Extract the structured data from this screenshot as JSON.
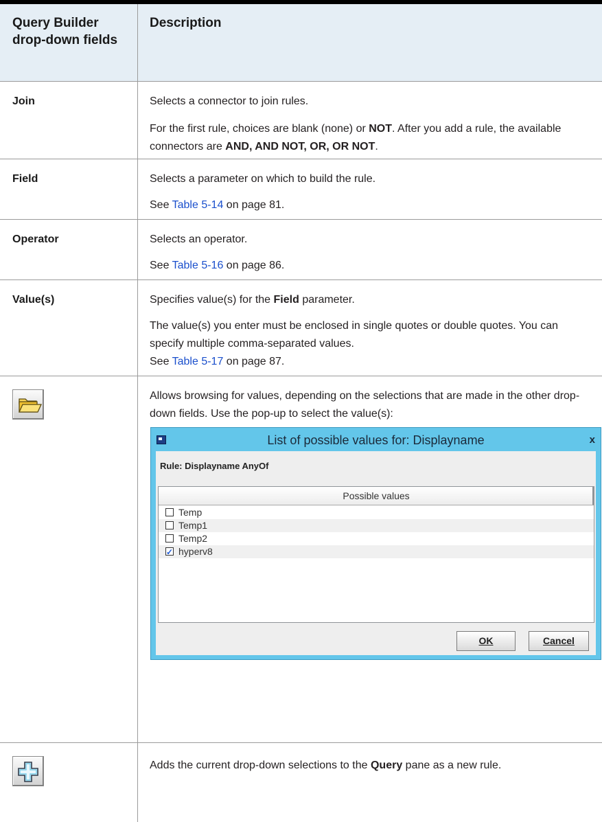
{
  "header": {
    "col1": "Query Builder drop-down fields",
    "col2": "Description"
  },
  "rows": {
    "join": {
      "label": "Join",
      "p1": "Selects a connector to join rules.",
      "p2a": "For the first rule, choices are blank (none) or ",
      "p2b": "NOT",
      "p2c": ". After you add a rule, the available connectors are ",
      "p2d": "AND, AND NOT, OR, OR NOT",
      "p2e": "."
    },
    "field": {
      "label": "Field",
      "p1": "Selects a parameter on which to build the rule.",
      "see": "See ",
      "link": "Table 5-14",
      "tail": " on page 81."
    },
    "operator": {
      "label": "Operator",
      "p1": "Selects an operator.",
      "see": "See ",
      "link": "Table 5-16",
      "tail": " on page 86."
    },
    "values": {
      "label": "Value(s)",
      "p1a": "Specifies value(s) for the ",
      "p1b": "Field",
      "p1c": " parameter.",
      "p2": "The value(s) you enter must be enclosed in single quotes or double quotes. You can specify multiple comma-separated values.",
      "see": "See ",
      "link": "Table 5-17",
      "tail": " on page 87."
    },
    "browse": {
      "icon": "folder-icon",
      "p1": "Allows browsing for values, depending on the selections that are made in the other drop-down fields. Use the pop-up to select the value(s):"
    },
    "add": {
      "icon": "plus-icon",
      "p1a": "Adds the current drop-down selections to the ",
      "p1b": "Query",
      "p1c": " pane as a new rule."
    }
  },
  "dialog": {
    "title": "List of possible values for: Displayname",
    "close": "x",
    "rule_label": "Rule: Displayname AnyOf",
    "column_header": "Possible values",
    "items": [
      {
        "label": "Temp",
        "checked": false
      },
      {
        "label": "Temp1",
        "checked": false
      },
      {
        "label": "Temp2",
        "checked": false
      },
      {
        "label": "hyperv8",
        "checked": true
      }
    ],
    "ok": "OK",
    "cancel": "Cancel"
  },
  "colors": {
    "header_bg": "#e5eef5",
    "link": "#1a4fcc",
    "dialog_frame": "#63c6ea",
    "check": "#1e5bd6"
  }
}
